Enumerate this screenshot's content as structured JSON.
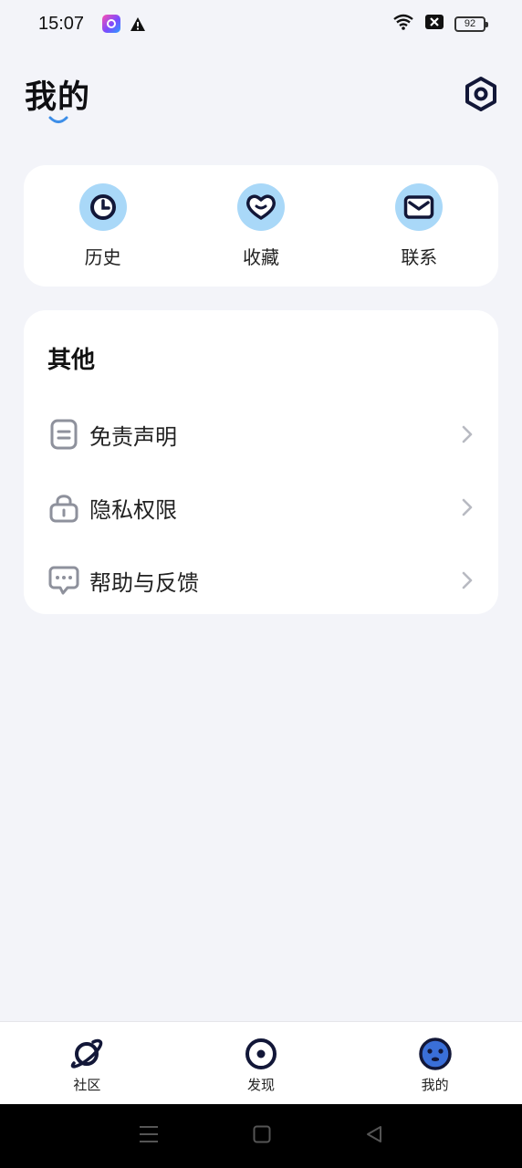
{
  "status_bar": {
    "time": "15:07",
    "battery": "92"
  },
  "header": {
    "title": "我的"
  },
  "quick_actions": [
    {
      "label": "历史",
      "icon": "clock-icon"
    },
    {
      "label": "收藏",
      "icon": "heart-icon"
    },
    {
      "label": "联系",
      "icon": "mail-icon"
    }
  ],
  "other": {
    "title": "其他",
    "items": [
      {
        "label": "免责声明",
        "icon": "document-icon"
      },
      {
        "label": "隐私权限",
        "icon": "lock-icon"
      },
      {
        "label": "帮助与反馈",
        "icon": "chat-icon"
      }
    ]
  },
  "tabs": [
    {
      "label": "社区",
      "icon": "planet-icon"
    },
    {
      "label": "发现",
      "icon": "eye-icon"
    },
    {
      "label": "我的",
      "icon": "face-icon"
    }
  ],
  "colors": {
    "accent": "#a9d8f8",
    "dark": "#121738",
    "background": "#f3f4f9"
  }
}
